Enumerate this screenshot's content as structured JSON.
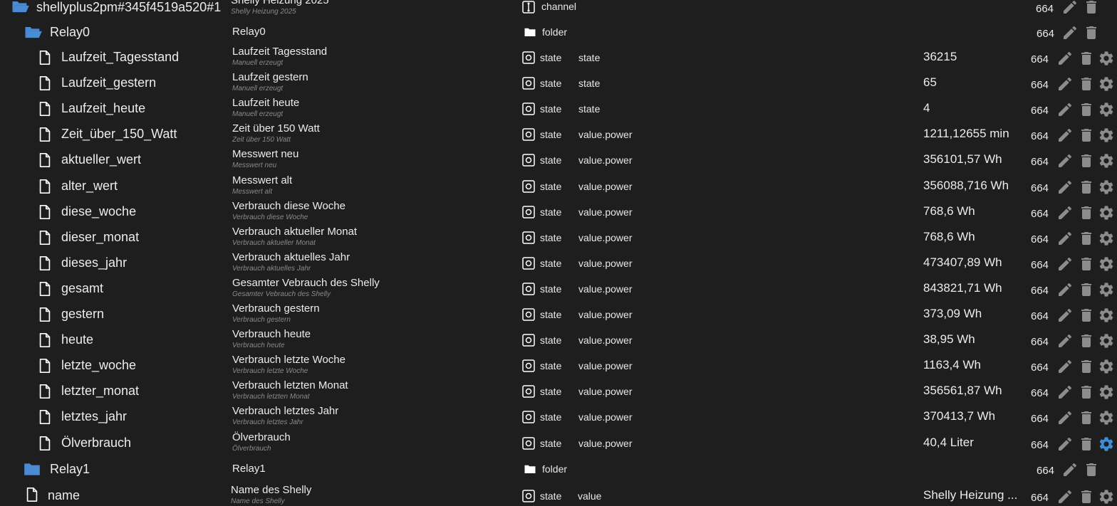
{
  "colors": {
    "background": "#1e1e1e",
    "text": "#ececec",
    "subtext": "#8a8a8a",
    "folder": "#4a8bd4",
    "icon_gray": "#8c8c8c",
    "gear_active": "#3b8fd6"
  },
  "device": {
    "id": "shellyplus2pm#345f4519a520#1",
    "name": "Shelly Heizung 2025",
    "name_sub": "Shelly Heizung 2025",
    "type": "channel",
    "acl": "664"
  },
  "relay0": {
    "id": "Relay0",
    "name": "Relay0",
    "type": "folder",
    "acl": "664"
  },
  "states": [
    {
      "id": "Laufzeit_Tagesstand",
      "name": "Laufzeit Tagesstand",
      "sub": "Manuell erzeugt",
      "type": "state",
      "role": "state",
      "value": "36215",
      "acl": "664"
    },
    {
      "id": "Laufzeit_gestern",
      "name": "Laufzeit gestern",
      "sub": "Manuell erzeugt",
      "type": "state",
      "role": "state",
      "value": "65",
      "acl": "664"
    },
    {
      "id": "Laufzeit_heute",
      "name": "Laufzeit heute",
      "sub": "Manuell erzeugt",
      "type": "state",
      "role": "state",
      "value": "4",
      "acl": "664"
    },
    {
      "id": "Zeit_über_150_Watt",
      "name": "Zeit über 150 Watt",
      "sub": "Zeit über 150 Watt",
      "type": "state",
      "role": "value.power",
      "value": "1211,12655 min",
      "acl": "664"
    },
    {
      "id": "aktueller_wert",
      "name": "Messwert neu",
      "sub": "Messwert neu",
      "type": "state",
      "role": "value.power",
      "value": "356101,57 Wh",
      "acl": "664"
    },
    {
      "id": "alter_wert",
      "name": "Messwert alt",
      "sub": "Messwert alt",
      "type": "state",
      "role": "value.power",
      "value": "356088,716 Wh",
      "acl": "664"
    },
    {
      "id": "diese_woche",
      "name": "Verbrauch diese Woche",
      "sub": "Verbrauch diese Woche",
      "type": "state",
      "role": "value.power",
      "value": "768,6 Wh",
      "acl": "664"
    },
    {
      "id": "dieser_monat",
      "name": "Verbrauch aktueller Monat",
      "sub": "Verbrauch aktueller Monat",
      "type": "state",
      "role": "value.power",
      "value": "768,6 Wh",
      "acl": "664"
    },
    {
      "id": "dieses_jahr",
      "name": "Verbrauch aktuelles Jahr",
      "sub": "Verbrauch aktuelles Jahr",
      "type": "state",
      "role": "value.power",
      "value": "473407,89 Wh",
      "acl": "664"
    },
    {
      "id": "gesamt",
      "name": "Gesamter Vebrauch des Shelly",
      "sub": "Gesamter Vebrauch des Shelly",
      "type": "state",
      "role": "value.power",
      "value": "843821,71 Wh",
      "acl": "664"
    },
    {
      "id": "gestern",
      "name": "Verbrauch gestern",
      "sub": "Verbrauch gestern",
      "type": "state",
      "role": "value.power",
      "value": "373,09 Wh",
      "acl": "664"
    },
    {
      "id": "heute",
      "name": "Verbrauch heute",
      "sub": "Verbrauch heute",
      "type": "state",
      "role": "value.power",
      "value": "38,95 Wh",
      "acl": "664"
    },
    {
      "id": "letzte_woche",
      "name": "Verbrauch letzte Woche",
      "sub": "Verbrauch letzte Woche",
      "type": "state",
      "role": "value.power",
      "value": "1163,4 Wh",
      "acl": "664"
    },
    {
      "id": "letzter_monat",
      "name": "Verbrauch letzten Monat",
      "sub": "Verbrauch letzten Monat",
      "type": "state",
      "role": "value.power",
      "value": "356561,87 Wh",
      "acl": "664"
    },
    {
      "id": "letztes_jahr",
      "name": "Verbrauch letztes Jahr",
      "sub": "Verbrauch letztes Jahr",
      "type": "state",
      "role": "value.power",
      "value": "370413,7 Wh",
      "acl": "664"
    },
    {
      "id": "Ölverbrauch",
      "name": "Ölverbrauch",
      "sub": "Ölverbrauch",
      "type": "state",
      "role": "value.power",
      "value": "40,4 Liter",
      "acl": "664",
      "gear_active": true
    }
  ],
  "relay1": {
    "id": "Relay1",
    "name": "Relay1",
    "type": "folder",
    "acl": "664"
  },
  "name_state": {
    "id": "name",
    "name": "Name des Shelly",
    "sub": "Name des Shelly",
    "type": "state",
    "role": "value",
    "value": "Shelly Heizung ...",
    "acl": "664"
  }
}
